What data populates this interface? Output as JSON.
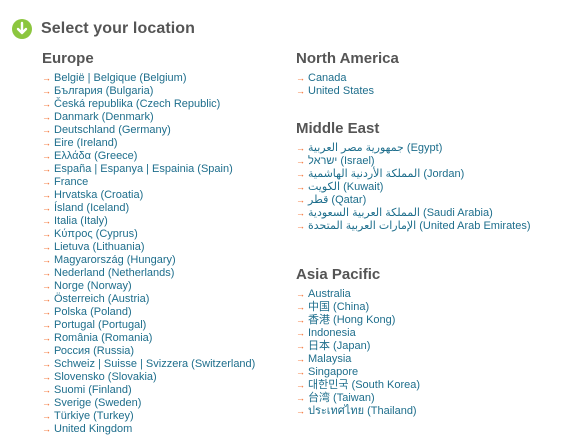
{
  "page": {
    "title": "Select your location",
    "icon": "down-arrow-circle-icon",
    "colors": {
      "title": "#555555",
      "link": "#1e6e8c",
      "arrow": "#f26522",
      "icon": "#8cc63f"
    }
  },
  "regions": {
    "europe": {
      "title": "Europe",
      "countries": [
        "België | Belgique (Belgium)",
        "България (Bulgaria)",
        "Česká republika (Czech Republic)",
        "Danmark (Denmark)",
        "Deutschland (Germany)",
        "Eire (Ireland)",
        "Ελλάδα (Greece)",
        "España | Espanya | Espainia (Spain)",
        "France",
        "Hrvatska (Croatia)",
        "Ísland (Iceland)",
        "Italia (Italy)",
        "Κύπρος (Cyprus)",
        "Lietuva (Lithuania)",
        "Magyarország (Hungary)",
        "Nederland (Netherlands)",
        "Norge (Norway)",
        "Österreich (Austria)",
        "Polska (Poland)",
        "Portugal (Portugal)",
        "România (Romania)",
        "Россия (Russia)",
        "Schweiz | Suisse | Svizzera (Switzerland)",
        "Slovensko (Slovakia)",
        "Suomi (Finland)",
        "Sverige (Sweden)",
        "Türkiye (Turkey)",
        "United Kingdom"
      ]
    },
    "north_america": {
      "title": "North America",
      "countries": [
        "Canada",
        "United States"
      ]
    },
    "middle_east": {
      "title": "Middle East",
      "countries": [
        "جمهورية مصر العربية (Egypt)",
        "ישראל (Israel)",
        "المملكة الأردنية الهاشمية (Jordan)",
        "الكويت (Kuwait)",
        "قطر (Qatar)",
        "المملكة العربية السعودية (Saudi Arabia)",
        "الإمارات العربية المتحدة (United Arab Emirates)"
      ]
    },
    "asia_pacific": {
      "title": "Asia Pacific",
      "countries": [
        "Australia",
        "中国 (China)",
        "香港 (Hong Kong)",
        "Indonesia",
        "日本 (Japan)",
        "Malaysia",
        "Singapore",
        "대한민국 (South Korea)",
        "台湾 (Taiwan)",
        "ประเทศไทย (Thailand)"
      ]
    }
  }
}
